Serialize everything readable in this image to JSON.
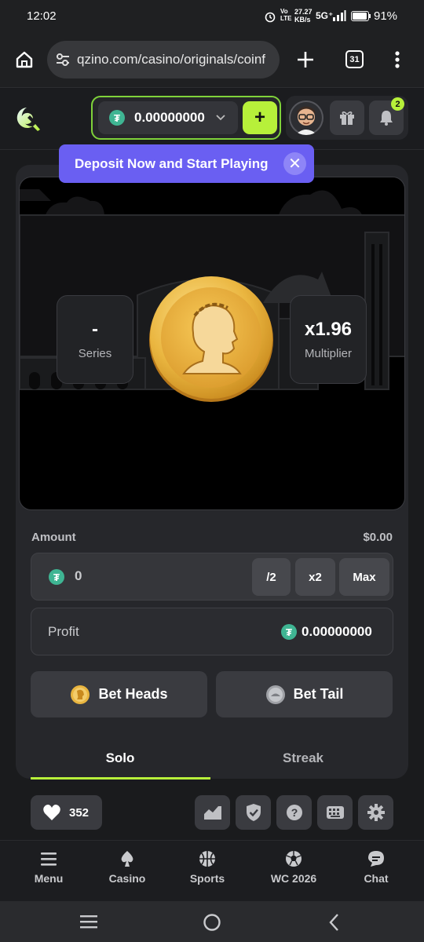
{
  "status_bar": {
    "time": "12:02",
    "net_speed_top": "27.27",
    "net_speed_bottom": "KB/s",
    "net_type": "5G⁺",
    "volte": "LTE",
    "battery": "91%"
  },
  "browser": {
    "url": "qzino.com/casino/originals/coinf",
    "tab_count": "31"
  },
  "header": {
    "balance": "0.00000000",
    "currency_symbol": "₮",
    "deposit_label": "+",
    "notification_count": "2"
  },
  "banner": {
    "text": "Deposit Now and Start Playing",
    "close_label": "✕"
  },
  "game": {
    "series_value": "-",
    "series_label": "Series",
    "multiplier_value": "x1.96",
    "multiplier_label": "Multiplier"
  },
  "bet": {
    "amount_label": "Amount",
    "amount_usd": "$0.00",
    "amount_value": "0",
    "half_label": "/2",
    "double_label": "x2",
    "max_label": "Max",
    "profit_label": "Profit",
    "profit_value": "0.00000000",
    "heads_label": "Bet Heads",
    "tail_label": "Bet Tail"
  },
  "tabs": [
    {
      "label": "Solo",
      "active": true
    },
    {
      "label": "Streak",
      "active": false
    }
  ],
  "footer_tools": {
    "likes": "352"
  },
  "bottom_nav": [
    {
      "label": "Menu",
      "icon": "menu-icon"
    },
    {
      "label": "Casino",
      "icon": "spade-icon"
    },
    {
      "label": "Sports",
      "icon": "basketball-icon"
    },
    {
      "label": "WC 2026",
      "icon": "soccer-ball-icon"
    },
    {
      "label": "Chat",
      "icon": "chat-icon"
    }
  ],
  "colors": {
    "accent": "#b7f03a",
    "banner": "#6a5ff2",
    "tether": "#3fb593",
    "coin": "#e9b53f"
  }
}
